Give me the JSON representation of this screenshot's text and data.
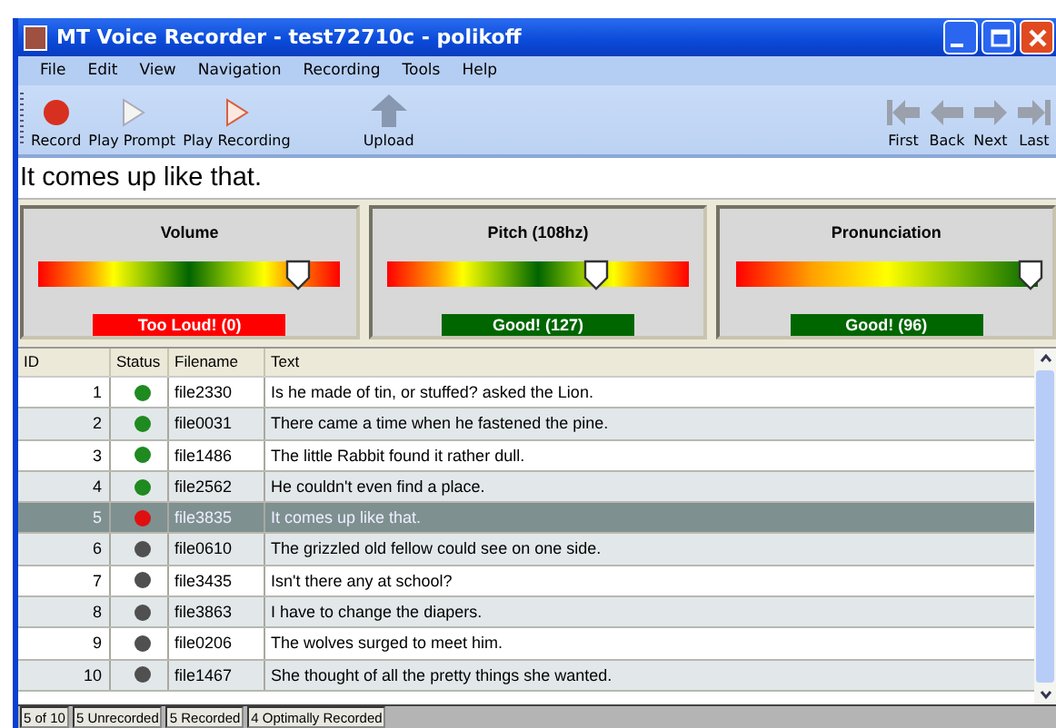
{
  "window": {
    "title": "MT Voice Recorder - test72710c - polikoff"
  },
  "menu": [
    "File",
    "Edit",
    "View",
    "Navigation",
    "Recording",
    "Tools",
    "Help"
  ],
  "toolbar_left": [
    {
      "kind": "record",
      "label": "Record"
    },
    {
      "kind": "play_prompt",
      "label": "Play Prompt"
    },
    {
      "kind": "play_recording",
      "label": "Play Recording"
    },
    {
      "kind": "upload",
      "label": "Upload"
    }
  ],
  "toolbar_right": [
    {
      "kind": "first",
      "label": "First"
    },
    {
      "kind": "back",
      "label": "Back"
    },
    {
      "kind": "next",
      "label": "Next"
    },
    {
      "kind": "last",
      "label": "Last"
    }
  ],
  "prompt": "It comes up like that.",
  "meters": [
    {
      "title": "Volume",
      "kind": "two_sided",
      "level": 0.86,
      "reading": "Too Loud! (0)",
      "color": "#ff0000"
    },
    {
      "title": "Pitch (108hz)",
      "kind": "two_sided",
      "level": 0.69,
      "reading": "Good! (127)",
      "color": "#006600"
    },
    {
      "title": "Pronunciation",
      "kind": "one_sided",
      "level": 0.98,
      "reading": "Good! (96)",
      "color": "#006600"
    }
  ],
  "table": {
    "columns": [
      "ID",
      "Status",
      "Filename",
      "Text"
    ],
    "rows": [
      {
        "id": "1",
        "color": "#1f8a1f",
        "filename": "file2330",
        "text": "Is he made of tin, or stuffed? asked the Lion.",
        "selected": false
      },
      {
        "id": "2",
        "color": "#1f8a1f",
        "filename": "file0031",
        "text": "There came a time when he fastened the pine.",
        "selected": false
      },
      {
        "id": "3",
        "color": "#1f8a1f",
        "filename": "file1486",
        "text": "The little Rabbit found it rather dull.",
        "selected": false
      },
      {
        "id": "4",
        "color": "#1f8a1f",
        "filename": "file2562",
        "text": "He couldn't even find a place.",
        "selected": false
      },
      {
        "id": "5",
        "color": "#e01010",
        "filename": "file3835",
        "text": "It comes up like that.",
        "selected": true
      },
      {
        "id": "6",
        "color": "#505050",
        "filename": "file0610",
        "text": "The grizzled old fellow could see on one side.",
        "selected": false
      },
      {
        "id": "7",
        "color": "#505050",
        "filename": "file3435",
        "text": "Isn't there any at school?",
        "selected": false
      },
      {
        "id": "8",
        "color": "#505050",
        "filename": "file3863",
        "text": "I have to change the diapers.",
        "selected": false
      },
      {
        "id": "9",
        "color": "#505050",
        "filename": "file0206",
        "text": "The wolves surged to meet him.",
        "selected": false
      },
      {
        "id": "10",
        "color": "#505050",
        "filename": "file1467",
        "text": "She thought of all the pretty things she wanted.",
        "selected": false
      }
    ]
  },
  "status_bar": [
    "5 of 10",
    "5 Unrecorded",
    "5 Recorded",
    "4 Optimally Recorded"
  ]
}
